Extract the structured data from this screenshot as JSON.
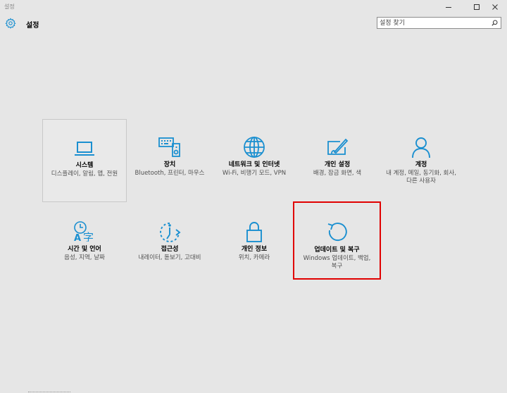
{
  "window": {
    "title": "설정",
    "controls": [
      "minimize-icon",
      "maximize-icon",
      "close-icon"
    ]
  },
  "header": {
    "icon": "gear-icon",
    "title": "설정",
    "search_placeholder": "설정 찾기",
    "search_icon": "search-icon"
  },
  "accent_color": "#1a8fd0",
  "highlight_color": "#e00000",
  "categories": [
    {
      "icon": "laptop-icon",
      "name": "시스템",
      "desc": "디스플레이, 알림, 앱, 전원"
    },
    {
      "icon": "keyboard-speaker-icon",
      "name": "장치",
      "desc": "Bluetooth, 프린터, 마우스"
    },
    {
      "icon": "globe-icon",
      "name": "네트워크 및 인터넷",
      "desc": "Wi-Fi, 비행기 모드, VPN"
    },
    {
      "icon": "personalization-icon",
      "name": "개인 설정",
      "desc": "배경, 잠금 화면, 색"
    },
    {
      "icon": "person-icon",
      "name": "계정",
      "desc": "내 계정, 메일, 동기화, 회사, 다른 사용자"
    },
    {
      "icon": "time-language-icon",
      "name": "시간 및 언어",
      "desc": "음성, 지역, 날짜"
    },
    {
      "icon": "ease-of-access-icon",
      "name": "접근성",
      "desc": "내레이터, 돋보기, 고대비"
    },
    {
      "icon": "lock-icon",
      "name": "개인 정보",
      "desc": "위치, 카메라"
    },
    {
      "icon": "refresh-icon",
      "name": "업데이트 및 복구",
      "desc": "Windows 업데이트, 백업, 복구"
    }
  ]
}
